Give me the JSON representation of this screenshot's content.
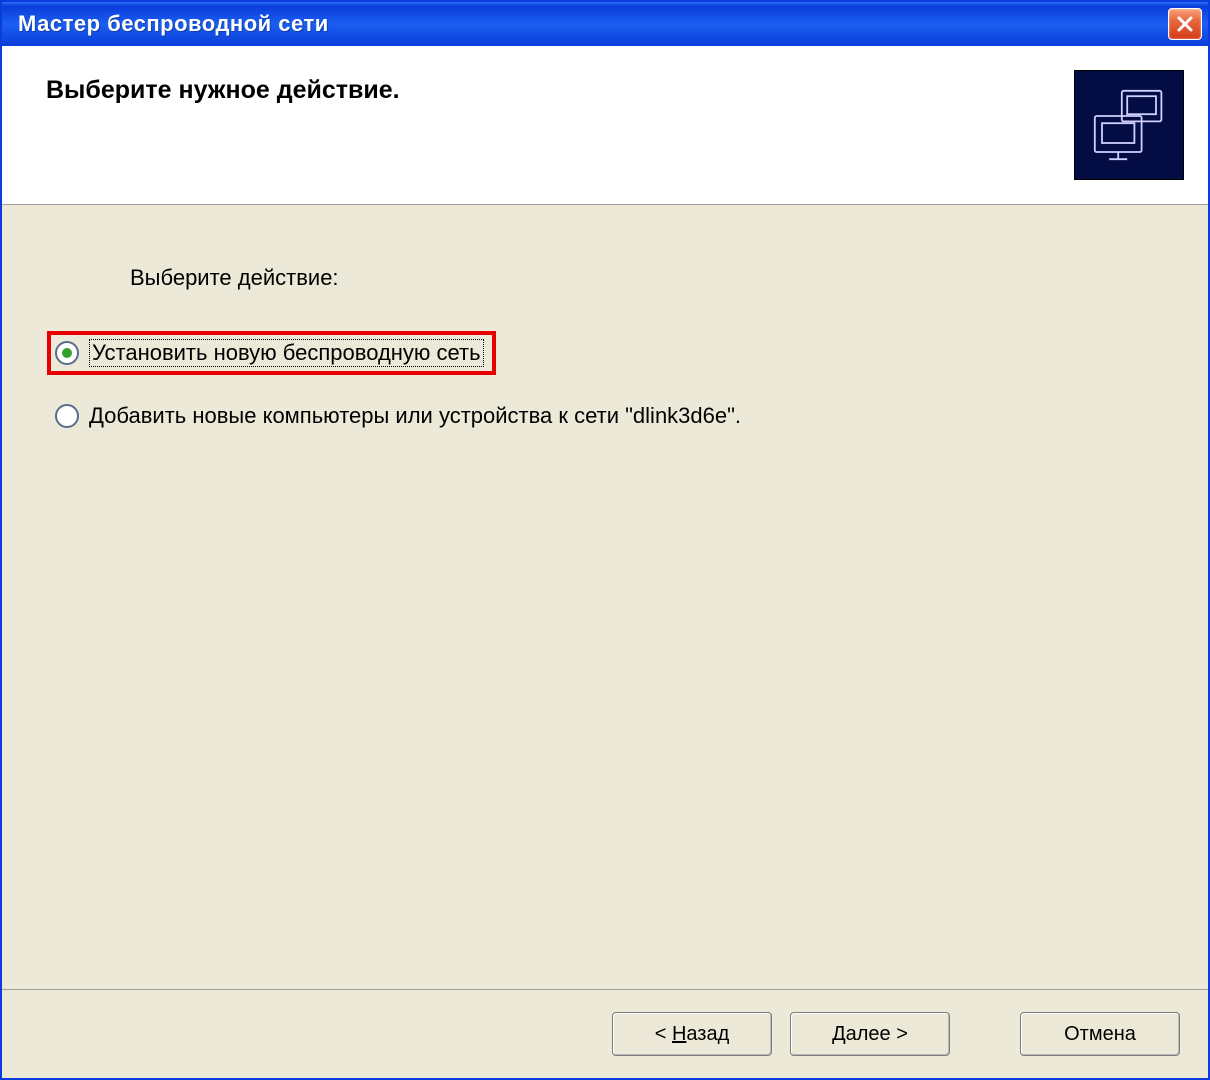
{
  "window": {
    "title": "Мастер беспроводной сети"
  },
  "header": {
    "title": "Выберите нужное действие."
  },
  "content": {
    "prompt": "Выберите действие:",
    "options": [
      {
        "label": "Установить новую беспроводную сеть",
        "selected": true,
        "highlighted": true
      },
      {
        "label": "Добавить новые компьютеры или устройства к сети \"dlink3d6e\".",
        "selected": false,
        "highlighted": false
      }
    ]
  },
  "footer": {
    "back_prefix": "< ",
    "back_mn": "Н",
    "back_rest": "азад",
    "next_mn": "Д",
    "next_rest": "алее >",
    "cancel": "Отмена"
  }
}
